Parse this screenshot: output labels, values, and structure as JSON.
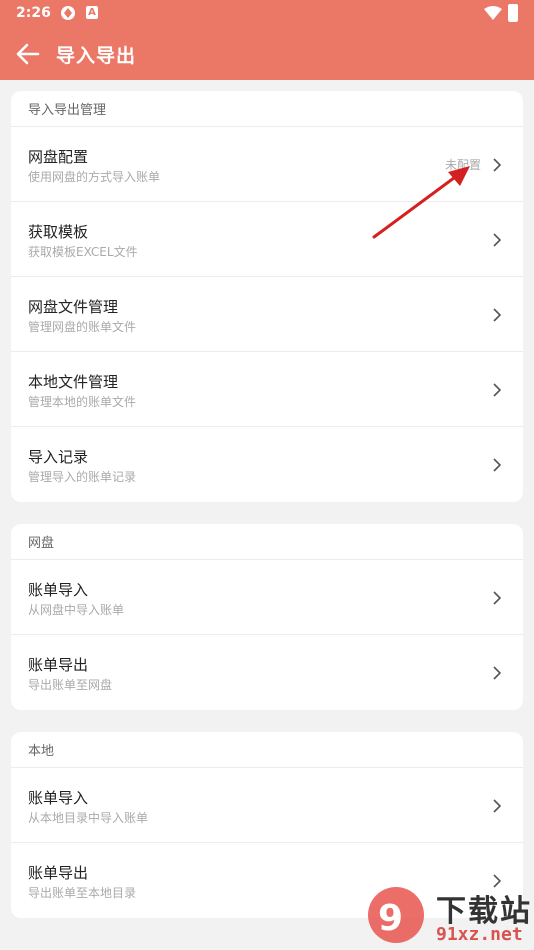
{
  "status_bar": {
    "time": "2:26",
    "app_icon_letter": "A"
  },
  "header": {
    "title": "导入导出"
  },
  "sections": [
    {
      "title": "导入导出管理",
      "items": [
        {
          "title": "网盘配置",
          "subtitle": "使用网盘的方式导入账单",
          "status": "未配置"
        },
        {
          "title": "获取模板",
          "subtitle": "获取模板EXCEL文件"
        },
        {
          "title": "网盘文件管理",
          "subtitle": "管理网盘的账单文件"
        },
        {
          "title": "本地文件管理",
          "subtitle": "管理本地的账单文件"
        },
        {
          "title": "导入记录",
          "subtitle": "管理导入的账单记录"
        }
      ]
    },
    {
      "title": "网盘",
      "items": [
        {
          "title": "账单导入",
          "subtitle": "从网盘中导入账单"
        },
        {
          "title": "账单导出",
          "subtitle": "导出账单至网盘"
        }
      ]
    },
    {
      "title": "本地",
      "items": [
        {
          "title": "账单导入",
          "subtitle": "从本地目录中导入账单"
        },
        {
          "title": "账单导出",
          "subtitle": "导出账单至本地目录"
        }
      ]
    }
  ],
  "watermark": {
    "text": "下载站",
    "url": "91xz.net"
  },
  "colors": {
    "accent": "#eb7766",
    "background": "#f2f2f2"
  }
}
